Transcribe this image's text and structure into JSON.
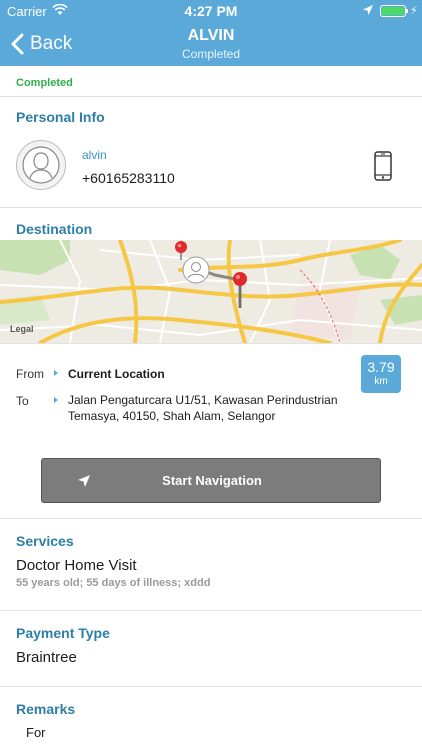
{
  "status_bar": {
    "carrier": "Carrier",
    "time": "4:27 PM",
    "battery_color": "#4cd964"
  },
  "nav": {
    "back_label": "Back",
    "title": "ALVIN",
    "subtitle": "Completed"
  },
  "status_pill": "Completed",
  "personal_info": {
    "title": "Personal Info",
    "name": "alvin",
    "phone": "+60165283110",
    "icon": "phone-icon"
  },
  "destination": {
    "title": "Destination",
    "map_legal": "Legal",
    "from_label": "From",
    "from_value": "Current Location",
    "to_label": "To",
    "to_value": "Jalan Pengaturcara U1/51, Kawasan Perindustrian Temasya, 40150, Shah Alam, Selangor",
    "distance_value": "3.79",
    "distance_unit": "km",
    "navigate_label": "Start Navigation"
  },
  "services": {
    "title": "Services",
    "name": "Doctor Home Visit",
    "description": "55 years old; 55 days of illness; xddd"
  },
  "payment": {
    "title": "Payment Type",
    "value": "Braintree"
  },
  "remarks": {
    "title": "Remarks",
    "value": "For"
  },
  "colors": {
    "header": "#5aa9d9",
    "section_title": "#2e7fa6",
    "status_green": "#2fae4f"
  }
}
